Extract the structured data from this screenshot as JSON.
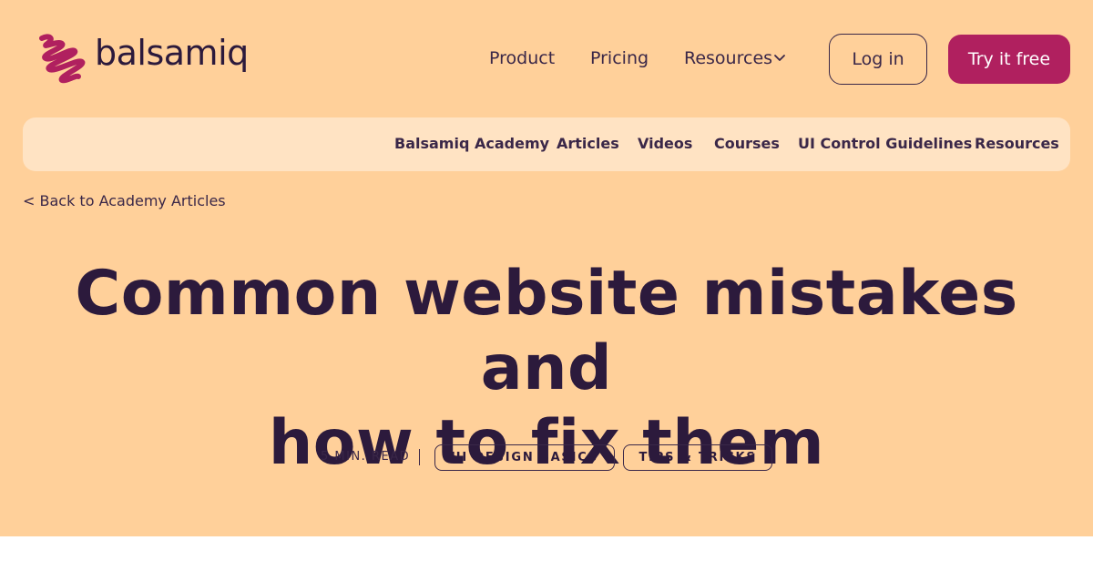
{
  "brand": {
    "name": "balsamiq",
    "accent": "#b0205f",
    "hero_bg": "#ffd09a",
    "subnav_bg": "#ffe3c3",
    "text": "#2c1a3c"
  },
  "nav": {
    "product": "Product",
    "pricing": "Pricing",
    "resources": "Resources",
    "resources_icon": "chevron-down-icon",
    "login": "Log in",
    "try": "Try it free"
  },
  "subnav": {
    "items": [
      "Balsamiq Academy",
      "Articles",
      "Videos",
      "Courses",
      "UI Control Guidelines",
      "Resources"
    ]
  },
  "back_link": "< Back to Academy Articles",
  "article": {
    "title_line1": "Common website mistakes and",
    "title_line2": "how to fix them",
    "read_time": "5 MIN. READ",
    "tags": [
      "UI DESIGN BASICS",
      "TIPS & TRICKS"
    ]
  }
}
